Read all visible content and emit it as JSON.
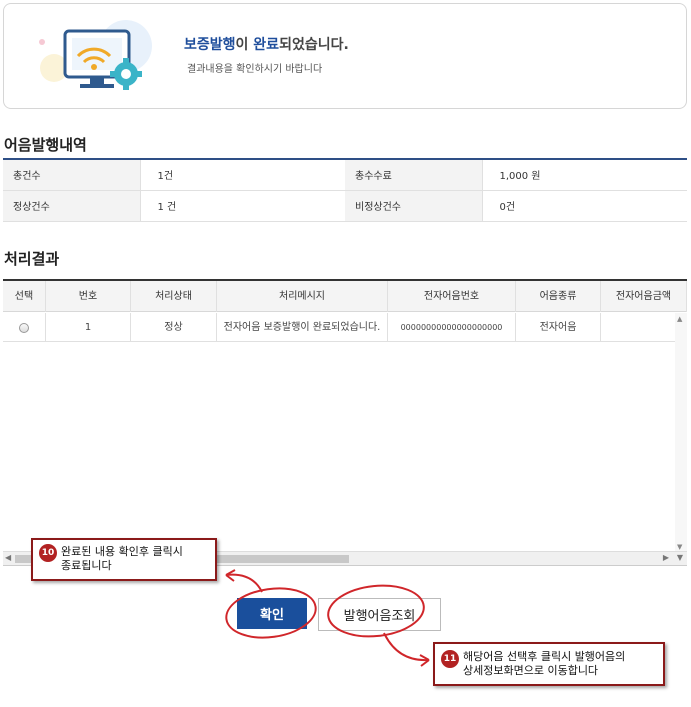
{
  "completion": {
    "title_highlight_1": "보증발행",
    "title_mid": "이 ",
    "title_highlight_2": "완료",
    "title_end": "되었습니다.",
    "subtitle": "결과내용을 확인하시기 바랍니다"
  },
  "summary": {
    "section_title": "어음발행내역",
    "rows": [
      [
        {
          "label": "총건수",
          "value": "1건"
        },
        {
          "label": "총수수료",
          "value": "1,000 원"
        }
      ],
      [
        {
          "label": "정상건수",
          "value": "1 건"
        },
        {
          "label": "비정상건수",
          "value": "0건"
        }
      ]
    ]
  },
  "results": {
    "section_title": "처리결과",
    "columns": [
      "선택",
      "번호",
      "처리상태",
      "처리메시지",
      "전자어음번호",
      "어음종류",
      "전자어음금액"
    ],
    "rows": [
      {
        "number": "1",
        "status": "정상",
        "message": "전자어음 보증발행이 완료되었습니다.",
        "note_number": "00000000000000000000",
        "note_type": "전자어음",
        "amount": ""
      }
    ]
  },
  "buttons": {
    "confirm": "확인",
    "lookup": "발행어음조회"
  },
  "callouts": [
    {
      "number": "10",
      "line1": "완료된 내용 확인후 클릭시",
      "line2": "종료됩니다"
    },
    {
      "number": "11",
      "line1": "해당어음 선택후 클릭시 발행어음의",
      "line2": "상세정보화면으로 이동합니다"
    }
  ],
  "colors": {
    "accent": "#1a4f9c",
    "callout_border": "#8b1a1a",
    "annotation_red": "#d0262a"
  }
}
